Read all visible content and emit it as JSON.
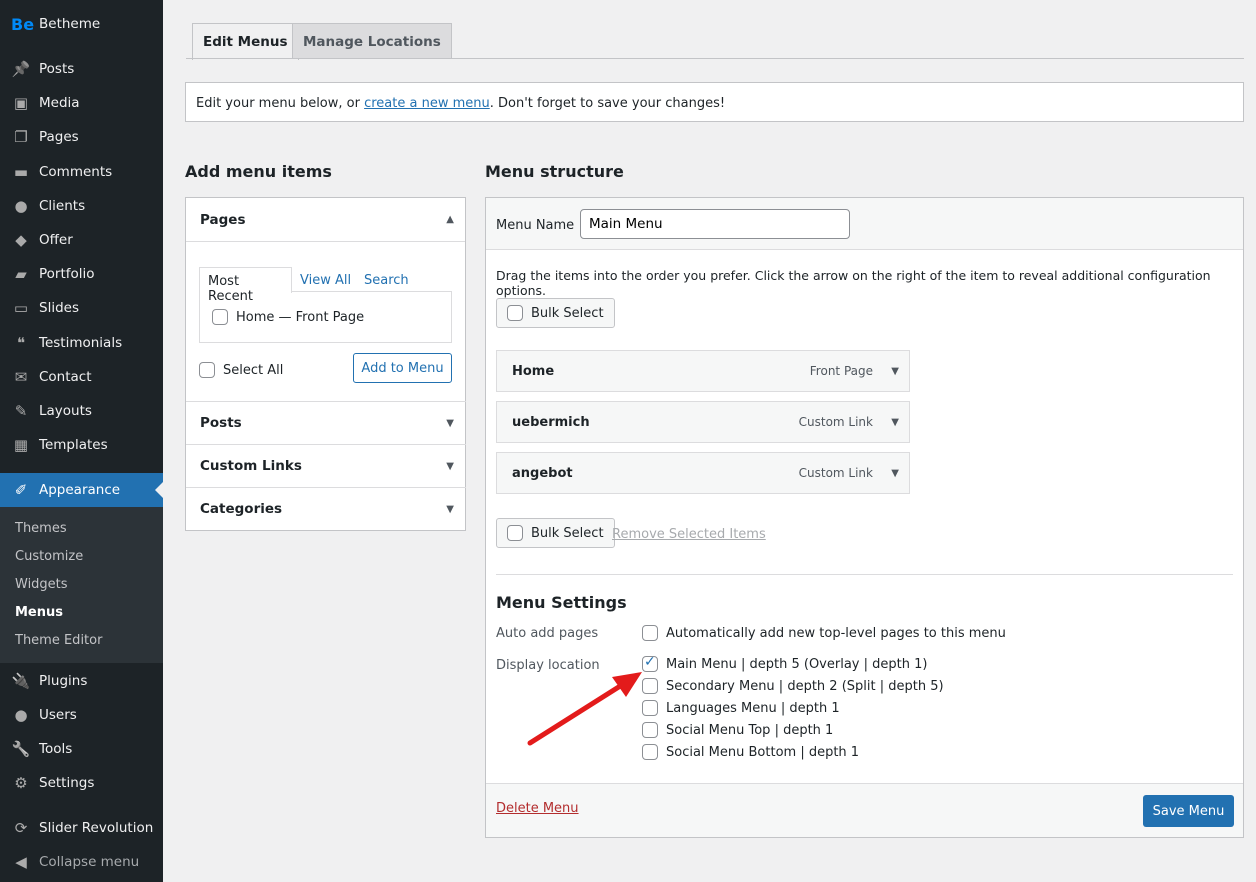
{
  "sidebar": {
    "brand": "Betheme",
    "items": [
      {
        "label": "Posts",
        "icon": "pin-icon"
      },
      {
        "label": "Media",
        "icon": "media-icon"
      },
      {
        "label": "Pages",
        "icon": "pages-icon"
      },
      {
        "label": "Comments",
        "icon": "comment-icon"
      },
      {
        "label": "Clients",
        "icon": "user-icon"
      },
      {
        "label": "Offer",
        "icon": "tag-icon"
      },
      {
        "label": "Portfolio",
        "icon": "folder-icon"
      },
      {
        "label": "Slides",
        "icon": "slides-icon"
      },
      {
        "label": "Testimonials",
        "icon": "quote-icon"
      },
      {
        "label": "Contact",
        "icon": "mail-icon"
      },
      {
        "label": "Layouts",
        "icon": "pencil-icon"
      },
      {
        "label": "Templates",
        "icon": "grid-icon"
      },
      {
        "label": "Appearance",
        "icon": "brush-icon"
      }
    ],
    "submenu": [
      "Themes",
      "Customize",
      "Widgets",
      "Menus",
      "Theme Editor"
    ],
    "items2": [
      {
        "label": "Plugins"
      },
      {
        "label": "Users"
      },
      {
        "label": "Tools"
      },
      {
        "label": "Settings"
      },
      {
        "label": "Slider Revolution"
      },
      {
        "label": "Collapse menu"
      }
    ]
  },
  "tabs": [
    "Edit Menus",
    "Manage Locations"
  ],
  "notice": {
    "before": "Edit your menu below, or ",
    "link": "create a new menu",
    "after": ". Don't forget to save your changes!"
  },
  "add_items": {
    "title": "Add menu items",
    "pages": "Pages",
    "subtabs": [
      "Most Recent",
      "View All",
      "Search"
    ],
    "page_item": "Home — Front Page",
    "select_all": "Select All",
    "add_button": "Add to Menu",
    "sections": [
      "Posts",
      "Custom Links",
      "Categories"
    ]
  },
  "structure": {
    "title": "Menu structure",
    "name_label": "Menu Name",
    "name_value": "Main Menu",
    "instructions": "Drag the items into the order you prefer. Click the arrow on the right of the item to reveal additional configuration options.",
    "bulk_select": "Bulk Select",
    "remove_selected": "Remove Selected Items",
    "items": [
      {
        "title": "Home",
        "type": "Front Page"
      },
      {
        "title": "uebermich",
        "type": "Custom Link"
      },
      {
        "title": "angebot",
        "type": "Custom Link"
      }
    ],
    "settings_title": "Menu Settings",
    "auto_add_label": "Auto add pages",
    "auto_add_text": "Automatically add new top-level pages to this menu",
    "display_label": "Display location",
    "locations": [
      {
        "label": "Main Menu | depth 5 (Overlay | depth 1)",
        "checked": true
      },
      {
        "label": "Secondary Menu | depth 2 (Split | depth 5)",
        "checked": false
      },
      {
        "label": "Languages Menu | depth 1",
        "checked": false
      },
      {
        "label": "Social Menu Top | depth 1",
        "checked": false
      },
      {
        "label": "Social Menu Bottom | depth 1",
        "checked": false
      }
    ],
    "delete": "Delete Menu",
    "save": "Save Menu"
  },
  "colors": {
    "accent": "#2271b1",
    "sidebar": "#1d2327",
    "arrow": "#e31b1b",
    "delete": "#b32d2e"
  }
}
